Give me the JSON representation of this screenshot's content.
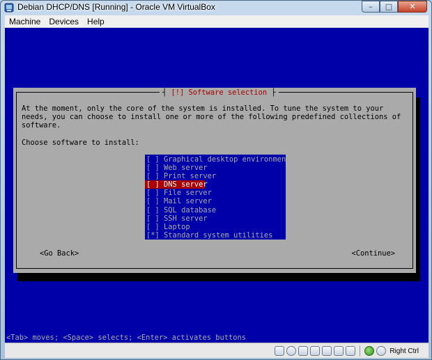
{
  "window": {
    "title": "Debian DHCP/DNS [Running] - Oracle VM VirtualBox",
    "controls": {
      "minimize": "–",
      "maximize": "□",
      "close": "✕"
    }
  },
  "menubar": {
    "items": [
      "Machine",
      "Devices",
      "Help"
    ]
  },
  "installer": {
    "dialog_title": "[!] Software selection",
    "description": "At the moment, only the core of the system is installed. To tune the system to your\nneeds, you can choose to install one or more of the following predefined collections of\nsoftware.",
    "prompt": "Choose software to install:",
    "options": [
      {
        "mark": "[ ]",
        "label": "Graphical desktop environment",
        "selected": false
      },
      {
        "mark": "[ ]",
        "label": "Web server",
        "selected": false
      },
      {
        "mark": "[ ]",
        "label": "Print server",
        "selected": false
      },
      {
        "mark": "[ ]",
        "label": "DNS server",
        "selected": true
      },
      {
        "mark": "[ ]",
        "label": "File server",
        "selected": false
      },
      {
        "mark": "[ ]",
        "label": "Mail server",
        "selected": false
      },
      {
        "mark": "[ ]",
        "label": "SQL database",
        "selected": false
      },
      {
        "mark": "[ ]",
        "label": "SSH server",
        "selected": false
      },
      {
        "mark": "[ ]",
        "label": "Laptop",
        "selected": false
      },
      {
        "mark": "[*]",
        "label": "Standard system utilities",
        "selected": false
      }
    ],
    "go_back": "<Go Back>",
    "continue": "<Continue>",
    "help_line": "<Tab> moves; <Space> selects; <Enter> activates buttons"
  },
  "statusbar": {
    "icons": [
      "hard-disk-icon",
      "optical-drive-icon",
      "usb-icon",
      "network-icon",
      "shared-folders-icon",
      "display-icon",
      "capture-icon",
      "mouse-integration-icon"
    ],
    "host_key": "Right Ctrl"
  },
  "colors": {
    "screen_bg": "#0000a8",
    "dialog_bg": "#aaaaaa",
    "highlight": "#a80000"
  }
}
